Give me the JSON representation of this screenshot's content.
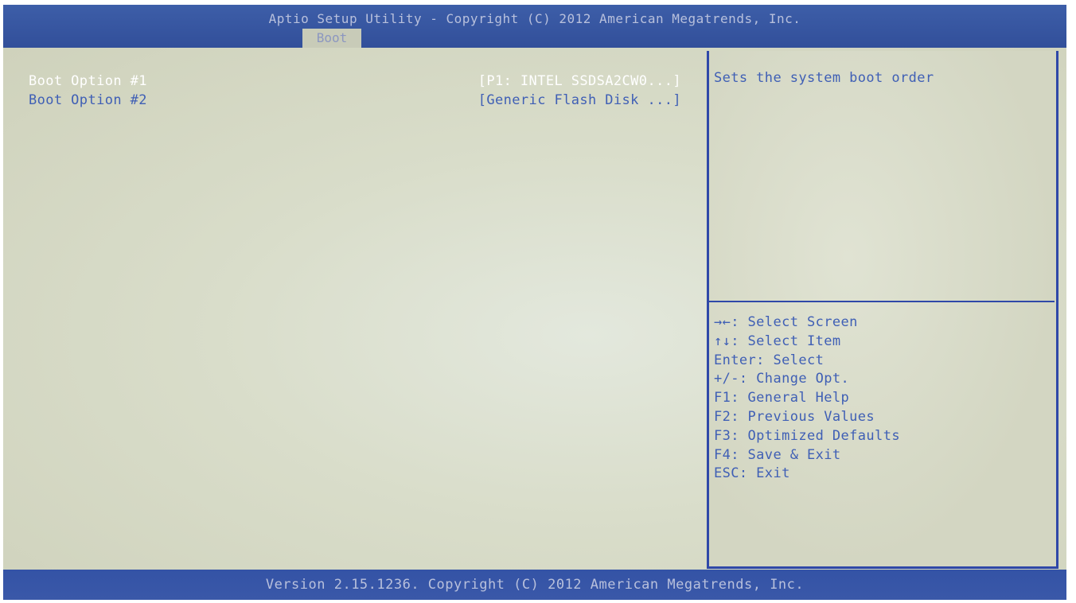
{
  "header": {
    "title": "Aptio Setup Utility - Copyright (C) 2012 American Megatrends, Inc.",
    "active_tab": "Boot"
  },
  "boot_options": [
    {
      "label": "Boot Option #1",
      "value": "[P1: INTEL SSDSA2CW0...]"
    },
    {
      "label": "Boot Option #2",
      "value": "[Generic Flash Disk ...]"
    }
  ],
  "help": {
    "description": "Sets the system boot order",
    "keys": [
      "→←: Select Screen",
      "↑↓: Select Item",
      "Enter: Select",
      "+/-: Change Opt.",
      "F1: General Help",
      "F2: Previous Values",
      "F3: Optimized Defaults",
      "F4: Save & Exit",
      "ESC: Exit"
    ]
  },
  "footer": {
    "text": "Version 2.15.1236. Copyright (C) 2012 American Megatrends, Inc."
  },
  "colors": {
    "header_bg": "#3d5ea8",
    "panel_bg": "#d6d9c4",
    "selected_text": "#ffffff",
    "normal_text": "#3f5fb5",
    "border": "#2f48a8"
  }
}
